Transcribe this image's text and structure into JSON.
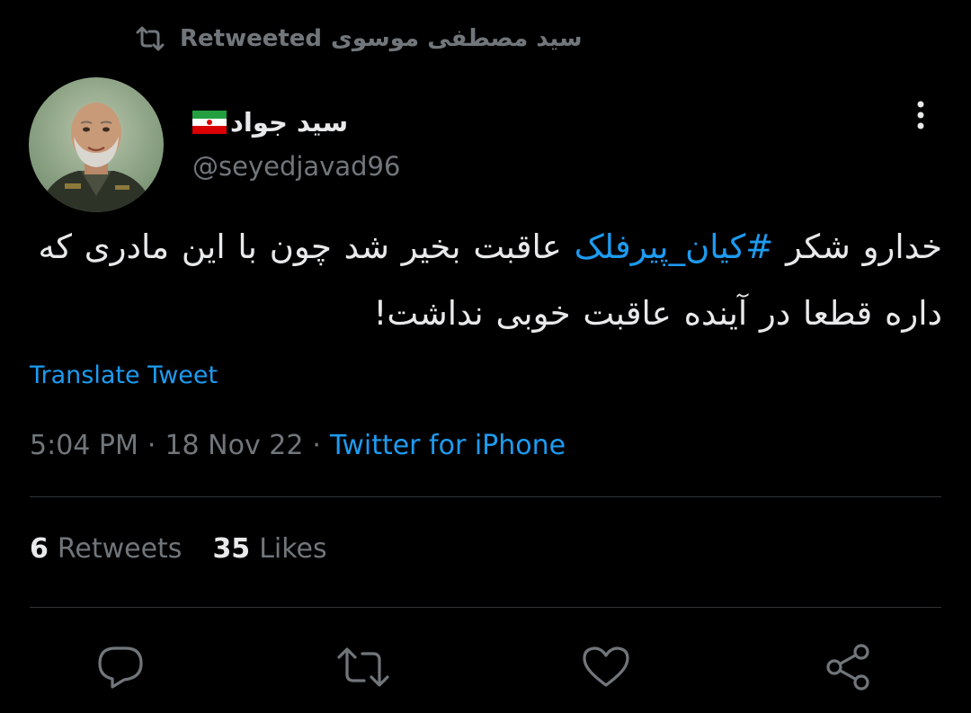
{
  "retweet_header": {
    "label": "Retweeted",
    "retweeter_name": "سید مصطفی موسوی",
    "icon": "retweet-icon"
  },
  "author": {
    "display_name": "سید جواد",
    "flag": "iran-flag-icon",
    "handle": "@seyedjavad96",
    "avatar": "avatar"
  },
  "tweet": {
    "text_part1": "خدارو شکر ",
    "hashtag": "#کیان_پیرفلک",
    "text_part2": " عاقبت بخیر شد چون با این مادری که داره قطعا در آینده عاقبت خوبی نداشت!"
  },
  "translate_label": "Translate Tweet",
  "meta": {
    "time": "5:04 PM",
    "sep1": "·",
    "date": "18 Nov 22",
    "sep2": "·",
    "source": "Twitter for iPhone"
  },
  "stats": {
    "retweets_count": "6",
    "retweets_label": "Retweets",
    "likes_count": "35",
    "likes_label": "Likes"
  },
  "actions": [
    "reply-icon",
    "retweet-icon",
    "like-icon",
    "share-icon"
  ],
  "colors": {
    "background": "#000000",
    "primary_text": "#e7e9ea",
    "secondary_text": "#71767b",
    "link": "#1d9bf0",
    "divider": "#2f3336"
  }
}
